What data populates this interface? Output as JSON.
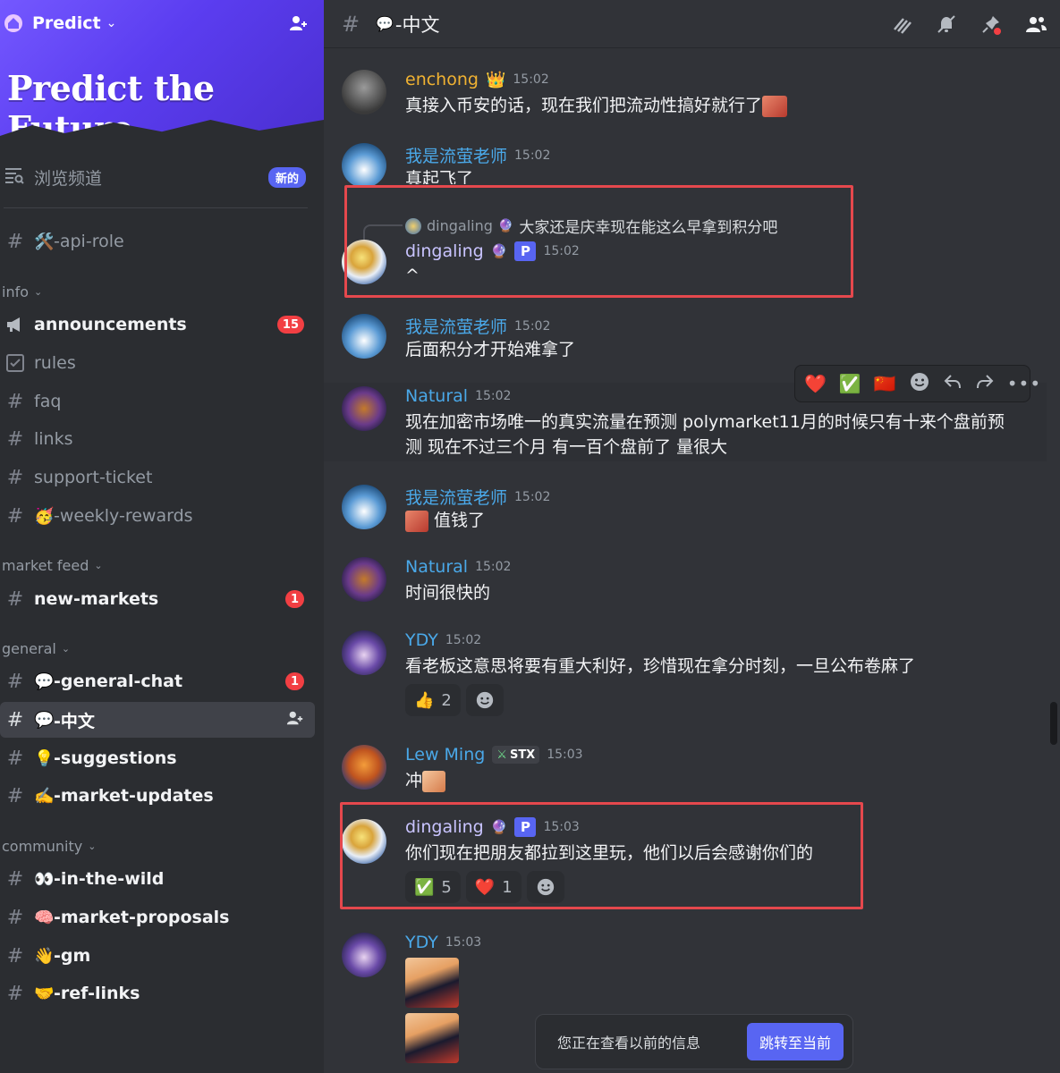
{
  "server": {
    "name": "Predict",
    "banner_title": "Predict the Future"
  },
  "sidebar": {
    "browse_label": "浏览频道",
    "new_badge": "新的",
    "pinned_channel": {
      "emoji": "🛠️",
      "name": "-api-role"
    },
    "categories": [
      {
        "label": "info"
      },
      {
        "label": "market feed"
      },
      {
        "label": "general"
      },
      {
        "label": "community"
      }
    ],
    "info_channels": [
      {
        "name": "announcements",
        "count": "15"
      },
      {
        "name": "rules"
      },
      {
        "name": "faq"
      },
      {
        "name": "links"
      },
      {
        "name": "support-ticket"
      },
      {
        "emoji": "🥳",
        "name": "-weekly-rewards"
      }
    ],
    "market_channels": [
      {
        "name": "new-markets",
        "count": "1"
      }
    ],
    "general_channels": [
      {
        "emoji": "💬",
        "name": "-general-chat",
        "count": "1"
      },
      {
        "emoji": "💬",
        "name": "-中文"
      },
      {
        "emoji": "💡",
        "name": "-suggestions"
      },
      {
        "emoji": "✍️",
        "name": "-market-updates"
      }
    ],
    "community_channels": [
      {
        "emoji": "👀",
        "name": "-in-the-wild"
      },
      {
        "emoji": "🧠",
        "name": "-market-proposals"
      },
      {
        "emoji": "👋",
        "name": "-gm"
      },
      {
        "emoji": "🤝",
        "name": "-ref-links"
      }
    ]
  },
  "channel": {
    "emoji": "💬",
    "title": "-中文"
  },
  "messages": [
    {
      "author": "enchong",
      "badge": "👑",
      "time": "15:02",
      "text": "真接入币安的话，现在我们把流动性搞好就行了",
      "color": "#f0b232"
    },
    {
      "author": "我是流萤老师",
      "time": "15:02",
      "text": "真起飞了",
      "color": "#4aa8e8"
    },
    {
      "reply_author": "dingaling",
      "reply_text": "大家还是庆幸现在能这么早拿到积分吧",
      "author": "dingaling",
      "tag": "P",
      "time": "15:02",
      "text": "^",
      "color": "#c9c4ff"
    },
    {
      "author": "我是流萤老师",
      "time": "15:02",
      "text": "后面积分才开始难拿了",
      "color": "#4aa8e8"
    },
    {
      "author": "Natural",
      "time": "15:02",
      "text_line1": "现在加密市场唯一的真实流量在预测  polymarket11月的时候只有十来个盘前预",
      "text_line2": "测  现在不过三个月   有一百个盘前了  量很大",
      "color": "#4aa8e8"
    },
    {
      "author": "我是流萤老师",
      "time": "15:02",
      "text": "值钱了",
      "color": "#4aa8e8"
    },
    {
      "author": "Natural",
      "time": "15:02",
      "text": "时间很快的",
      "color": "#4aa8e8"
    },
    {
      "author": "YDY",
      "time": "15:02",
      "text": "看老板这意思将要有重大利好，珍惜现在拿分时刻，一旦公布卷麻了",
      "color": "#4aa8e8",
      "reactions": [
        {
          "emoji": "👍",
          "count": "2"
        }
      ]
    },
    {
      "author": "Lew Ming",
      "role": "STX",
      "time": "15:03",
      "text": "冲",
      "color": "#4aa8e8"
    },
    {
      "author": "dingaling",
      "tag": "P",
      "time": "15:03",
      "text": "你们现在把朋友都拉到这里玩，他们以后会感谢你们的",
      "color": "#c9c4ff",
      "reactions": [
        {
          "emoji": "✅",
          "count": "5"
        },
        {
          "emoji": "❤️",
          "count": "1"
        }
      ]
    },
    {
      "author": "YDY",
      "time": "15:03",
      "color": "#4aa8e8"
    }
  ],
  "hover_actions": {
    "quick_reactions": [
      "❤️",
      "✅",
      "🇨🇳"
    ]
  },
  "jump_bar": {
    "text": "您正在查看以前的信息",
    "button": "跳转至当前"
  }
}
